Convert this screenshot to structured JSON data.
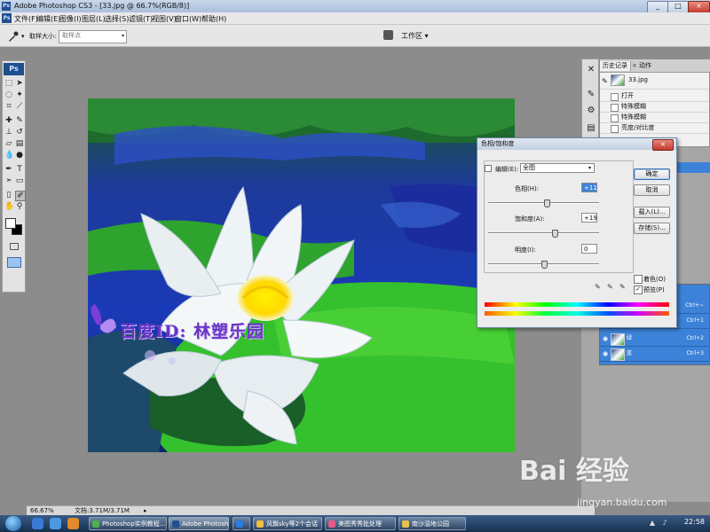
{
  "window": {
    "title": "Adobe Photoshop CS3 - [33.jpg @ 66.7%(RGB/8)]",
    "minimize": "_",
    "restore": "□",
    "close": "×"
  },
  "menubar": {
    "items": [
      "文件(F)",
      "编辑(E)",
      "图像(I)",
      "图层(L)",
      "选择(S)",
      "滤镜(T)",
      "视图(V)",
      "窗口(W)",
      "帮助(H)"
    ]
  },
  "options": {
    "sample_size_label": "取样大小:",
    "sample_size_value": "取样点",
    "workspace": "工作区 ▾"
  },
  "tools": {
    "logo": "Ps"
  },
  "history_panel": {
    "tabs": [
      "历史记录",
      "动作"
    ],
    "snapshot": "33.jpg",
    "items": [
      "打开",
      "特殊模糊",
      "特殊模糊",
      "亮度/对比度"
    ]
  },
  "layers_panel": {
    "rows": [
      {
        "name": "",
        "shortcut": "Ctrl+~"
      },
      {
        "name": "",
        "shortcut": "Ctrl+1"
      },
      {
        "name": "绿",
        "shortcut": "Ctrl+2"
      },
      {
        "name": "蓝",
        "shortcut": "Ctrl+3"
      }
    ]
  },
  "dialog": {
    "title": "色相/饱和度",
    "edit_label": "编辑(E):",
    "edit_value": "全图",
    "hue_label": "色相(H):",
    "hue_value": "+11",
    "hue_fraction": 0.53,
    "saturation_label": "饱和度(A):",
    "saturation_value": "+19",
    "saturation_fraction": 0.6,
    "lightness_label": "明度(I):",
    "lightness_value": "0",
    "lightness_fraction": 0.5,
    "buttons": {
      "ok": "确定",
      "cancel": "取消",
      "load": "载入(L)...",
      "save": "存储(S)..."
    },
    "colorize_label": "着色(O)",
    "preview_label": "预览(P)",
    "preview_checked": "✓"
  },
  "canvas": {
    "watermark": "百度ID: 林塑乐园"
  },
  "statusbar": {
    "zoom": "66.67%",
    "doc": "文档:3.71M/3.71M"
  },
  "taskbar": {
    "tasks": [
      "Photoshop实例教程...",
      "Adobe Photoshop ...",
      "",
      "风飘sky等2个会话",
      "美图秀秀批处理",
      "南沙湿地公园"
    ],
    "clock": "22:58"
  },
  "overlay": {
    "baidu_brand": "Bai 经验",
    "baidu_url": "jingyan.baidu.com"
  },
  "colors": {
    "accent_blue": "#3c82d8",
    "menubar_bg": "#e8e8e8",
    "workspace_gray": "#8c8c8c"
  }
}
